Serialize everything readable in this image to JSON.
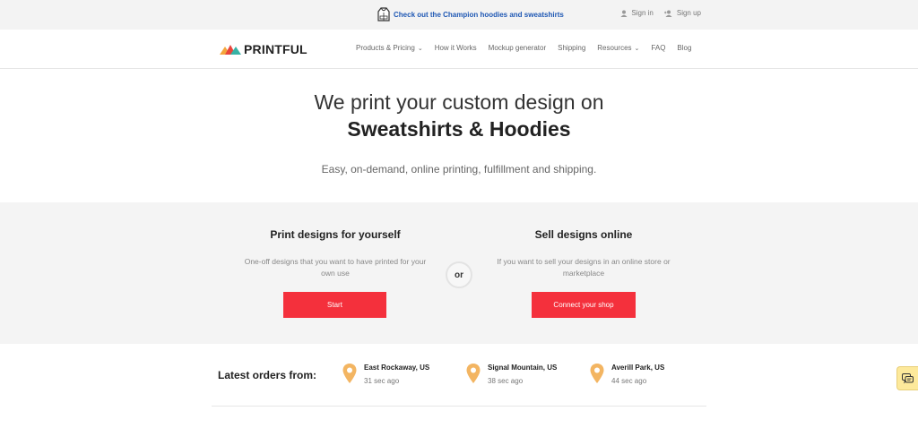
{
  "topbar": {
    "promo_text": "Check out the Champion hoodies and sweatshirts",
    "promo_icon": "hoodie-icon",
    "sign_in": "Sign in",
    "sign_up": "Sign up"
  },
  "nav": {
    "logo_text": "PRINTFUL",
    "items": [
      {
        "label": "Products & Pricing",
        "dropdown": true
      },
      {
        "label": "How it Works",
        "dropdown": false
      },
      {
        "label": "Mockup generator",
        "dropdown": false
      },
      {
        "label": "Shipping",
        "dropdown": false
      },
      {
        "label": "Resources",
        "dropdown": true
      },
      {
        "label": "FAQ",
        "dropdown": false
      },
      {
        "label": "Blog",
        "dropdown": false
      }
    ]
  },
  "hero": {
    "line1": "We print your custom design on",
    "line2": "Sweatshirts & Hoodies",
    "subtitle": "Easy, on-demand, online printing, fulfillment and shipping."
  },
  "choice": {
    "left": {
      "title": "Print designs for yourself",
      "description": "One-off designs that you want to have printed for your own use",
      "button": "Start"
    },
    "or_label": "or",
    "right": {
      "title": "Sell designs online",
      "description": "If you want to sell your designs in an online store or marketplace",
      "button": "Connect your shop"
    }
  },
  "orders": {
    "label": "Latest orders from:",
    "items": [
      {
        "location": "East Rockaway, US",
        "ago": "31 sec ago"
      },
      {
        "location": "Signal Mountain, US",
        "ago": "38 sec ago"
      },
      {
        "location": "Averill Park, US",
        "ago": "44 sec ago"
      }
    ]
  },
  "colors": {
    "accent_red": "#f4303c",
    "link_blue": "#1f58b4",
    "pin_orange": "#f3b562",
    "chat_yellow": "#fde99b"
  }
}
